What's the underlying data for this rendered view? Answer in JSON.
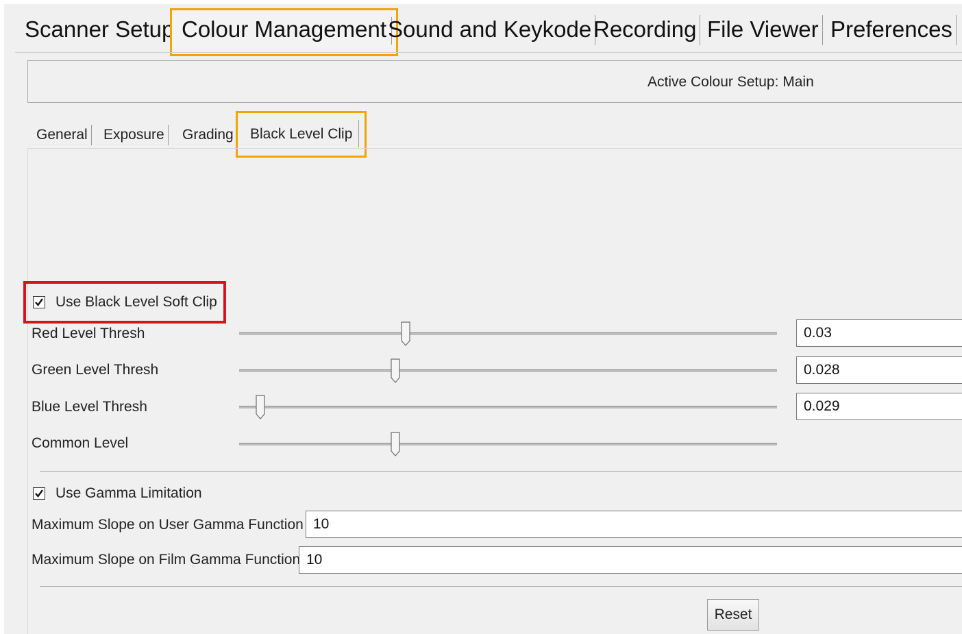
{
  "main_tabs": [
    {
      "label": "Scanner Setup",
      "active": false
    },
    {
      "label": "Colour Management",
      "active": true
    },
    {
      "label": "Sound and Keykode",
      "active": false
    },
    {
      "label": "Recording",
      "active": false
    },
    {
      "label": "File Viewer",
      "active": false
    },
    {
      "label": "Preferences",
      "active": false
    }
  ],
  "setup": {
    "label": "Active Colour Setup: Main"
  },
  "sub_tabs": [
    {
      "label": "General",
      "active": false
    },
    {
      "label": "Exposure",
      "active": false
    },
    {
      "label": "Grading",
      "active": false
    },
    {
      "label": "Black Level Clip",
      "active": true
    }
  ],
  "soft_clip": {
    "label": "Use Black Level Soft Clip",
    "checked": true
  },
  "sliders": [
    {
      "label": "Red Level Thresh",
      "value": "0.03",
      "position": 0.31
    },
    {
      "label": "Green Level Thresh",
      "value": "0.028",
      "position": 0.29
    },
    {
      "label": "Blue Level Thresh",
      "value": "0.029",
      "position": 0.04
    },
    {
      "label": "Common Level",
      "value": "",
      "position": 0.29
    }
  ],
  "gamma": {
    "label": "Use Gamma Limitation",
    "checked": true,
    "user_slope_label": "Maximum Slope on User Gamma Function",
    "user_slope_value": "10",
    "film_slope_label": "Maximum Slope on Film Gamma Function",
    "film_slope_value": "10"
  },
  "reset_label": "Reset",
  "colors": {
    "highlight_orange": "#f0a500",
    "highlight_red": "#d4141c"
  }
}
